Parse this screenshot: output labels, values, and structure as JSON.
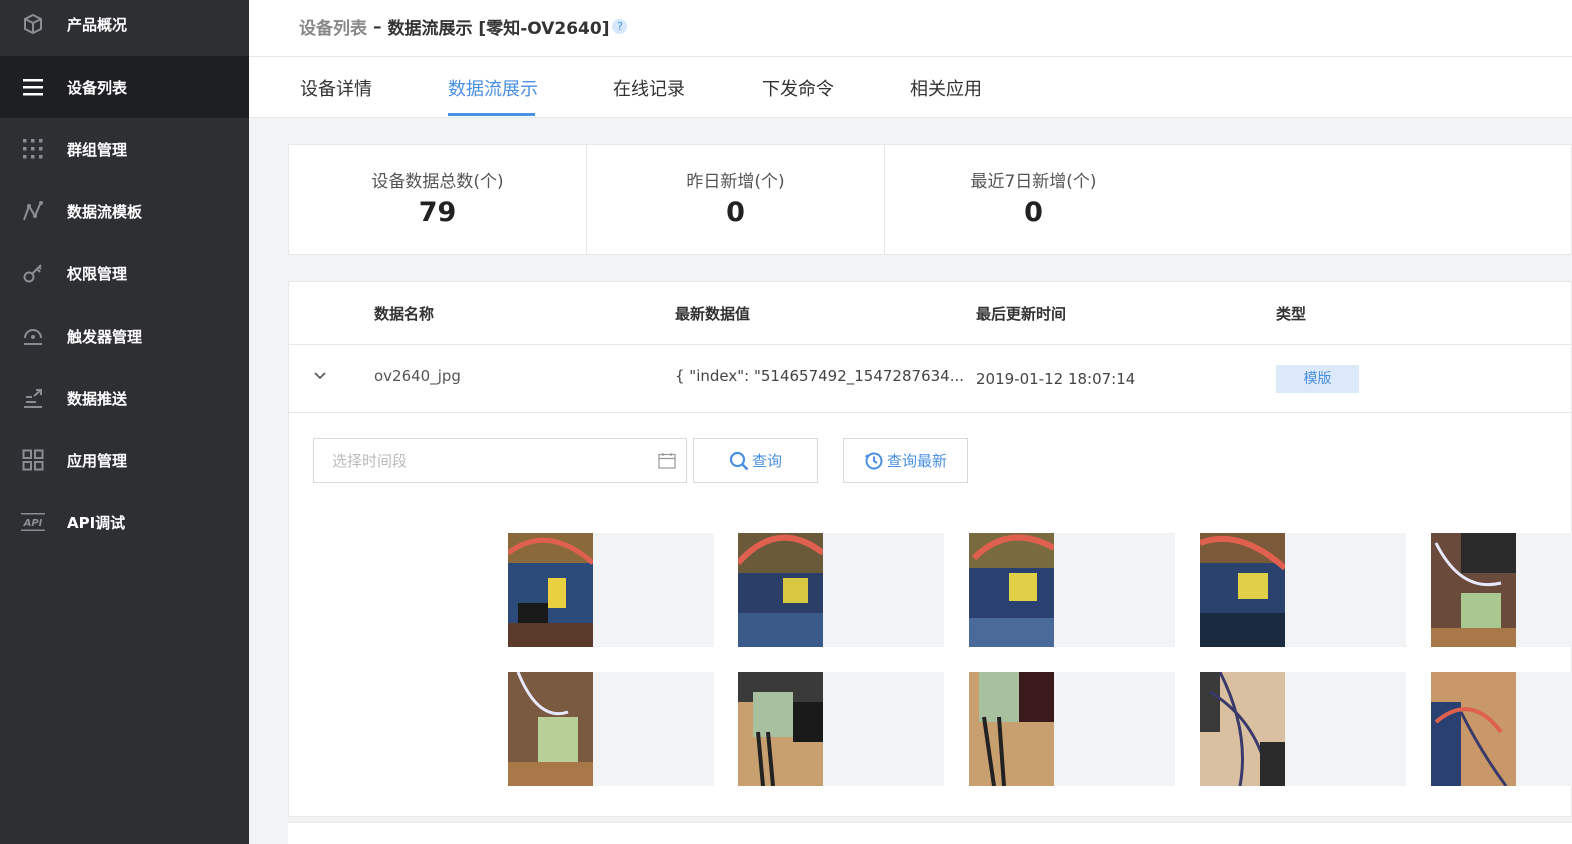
{
  "sidebar": {
    "items": [
      {
        "label": "产品概况",
        "icon": "cube-icon"
      },
      {
        "label": "设备列表",
        "icon": "list-icon",
        "active": true
      },
      {
        "label": "群组管理",
        "icon": "grid-dots-icon"
      },
      {
        "label": "数据流模板",
        "icon": "line-chart-icon"
      },
      {
        "label": "权限管理",
        "icon": "key-icon"
      },
      {
        "label": "触发器管理",
        "icon": "trigger-icon"
      },
      {
        "label": "数据推送",
        "icon": "push-icon"
      },
      {
        "label": "应用管理",
        "icon": "apps-icon"
      },
      {
        "label": "API调试",
        "icon": "api-icon"
      }
    ]
  },
  "header": {
    "crumb_parent": "设备列表",
    "crumb_separator": "–",
    "crumb_current": "数据流展示 [零知-OV2640]",
    "help": "?"
  },
  "tabs": [
    {
      "label": "设备详情"
    },
    {
      "label": "数据流展示",
      "active": true
    },
    {
      "label": "在线记录"
    },
    {
      "label": "下发命令"
    },
    {
      "label": "相关应用"
    }
  ],
  "stats": [
    {
      "label": "设备数据总数(个)",
      "value": "79"
    },
    {
      "label": "昨日新增(个)",
      "value": "0"
    },
    {
      "label": "最近7日新增(个)",
      "value": "0"
    }
  ],
  "table": {
    "headers": [
      "数据名称",
      "最新数据值",
      "最后更新时间",
      "类型"
    ],
    "row": {
      "name": "ov2640_jpg",
      "value": "{ \"index\": \"514657492_1547287634...",
      "time": "2019-01-12 18:07:14",
      "type": "模版"
    }
  },
  "query": {
    "placeholder": "选择时间段",
    "search_label": "查询",
    "latest_label": "查询最新"
  },
  "colors": {
    "accent": "#4a90e2",
    "sidebar_bg": "#2d2f33",
    "sidebar_active": "#1e1f22"
  }
}
